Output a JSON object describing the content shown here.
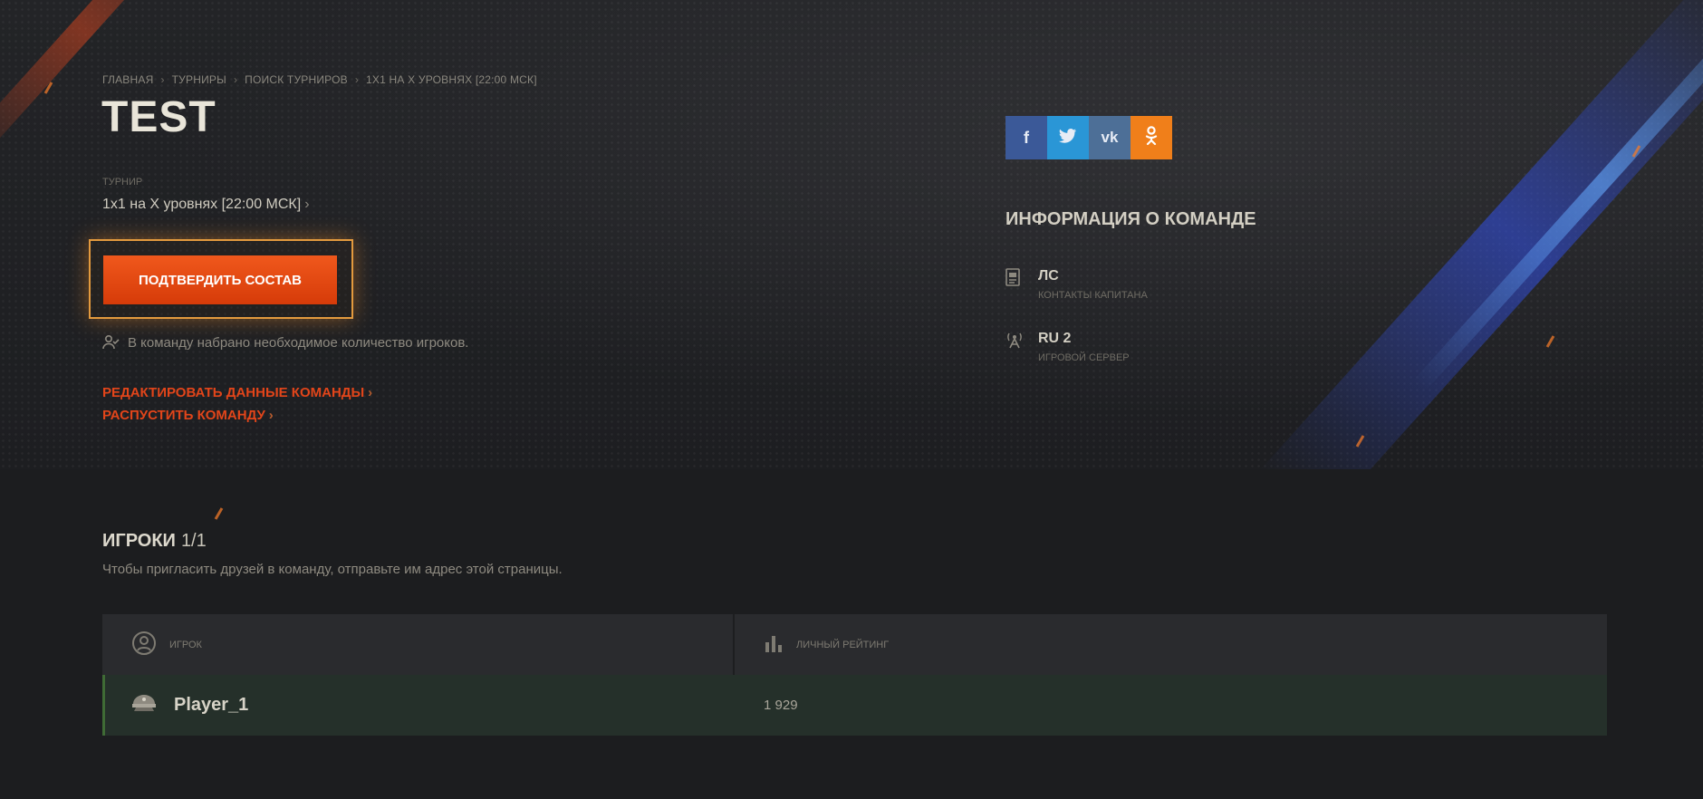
{
  "breadcrumb": [
    "ГЛАВНАЯ",
    "ТУРНИРЫ",
    "ПОИСК ТУРНИРОВ",
    "1X1 НА X УРОВНЯХ [22:00 МСК]"
  ],
  "team": {
    "name": "TEST",
    "tournament_label": "ТУРНИР",
    "tournament_name": "1х1 на X уровнях [22:00 МСК]",
    "confirm_button": "ПОДТВЕРДИТЬ СОСТАВ",
    "status": "В команду набрано необходимое количество игроков.",
    "edit_link": "РЕДАКТИРОВАТЬ ДАННЫЕ КОМАНДЫ",
    "disband_link": "РАСПУСТИТЬ КОМАНДУ"
  },
  "socials": [
    {
      "name": "facebook",
      "glyph": "f",
      "color": "#3b5998"
    },
    {
      "name": "twitter",
      "glyph": "🐦",
      "color": "#2a96d6"
    },
    {
      "name": "vk",
      "glyph": "vk",
      "color": "#4d6f97"
    },
    {
      "name": "odnoklassniki",
      "glyph": "ok",
      "color": "#f07f1a"
    }
  ],
  "info": {
    "title": "ИНФОРМАЦИЯ О КОМАНДЕ",
    "contacts_value": "ЛС",
    "contacts_label": "КОНТАКТЫ КАПИТАНА",
    "server_value": "RU 2",
    "server_label": "ИГРОВОЙ СЕРВЕР"
  },
  "players": {
    "title": "ИГРОКИ",
    "count": "1/1",
    "hint": "Чтобы пригласить друзей в команду, отправьте им адрес этой страницы.",
    "col_player": "ИГРОК",
    "col_rating": "ЛИЧНЫЙ РЕЙТИНГ",
    "rows": [
      {
        "name": "Player_1",
        "rating": "1 929"
      }
    ]
  }
}
